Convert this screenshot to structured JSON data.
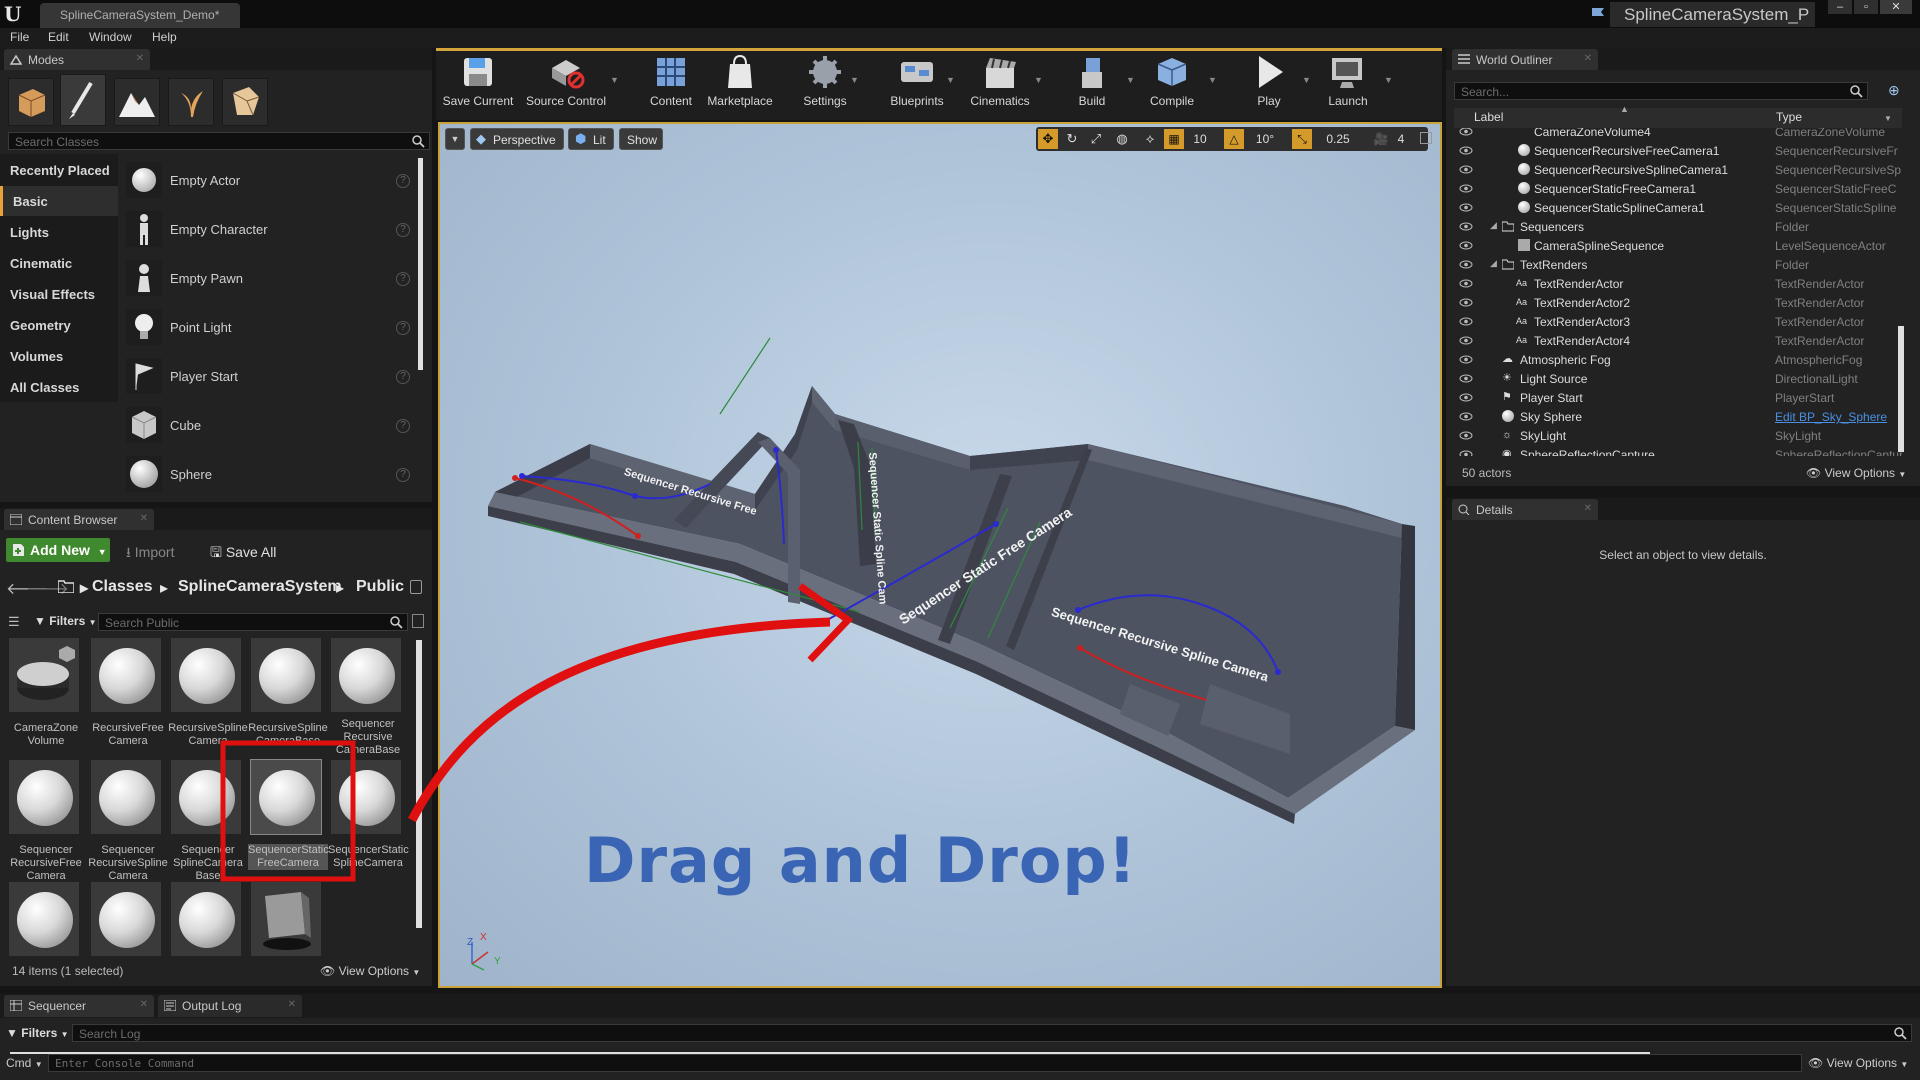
{
  "window": {
    "doc_tab": "SplineCameraSystem_Demo*",
    "project": "SplineCameraSystem_P"
  },
  "menu": [
    "File",
    "Edit",
    "Window",
    "Help"
  ],
  "modes": {
    "tab_label": "Modes",
    "search_placeholder": "Search Classes",
    "categories": [
      "Recently Placed",
      "Basic",
      "Lights",
      "Cinematic",
      "Visual Effects",
      "Geometry",
      "Volumes",
      "All Classes"
    ],
    "selected_category": "Basic",
    "items": [
      "Empty Actor",
      "Empty Character",
      "Empty Pawn",
      "Point Light",
      "Player Start",
      "Cube",
      "Sphere"
    ]
  },
  "toolbar": {
    "buttons": [
      "Save Current",
      "Source Control",
      "Content",
      "Marketplace",
      "Settings",
      "Blueprints",
      "Cinematics",
      "Build",
      "Compile",
      "Play",
      "Launch"
    ]
  },
  "viewport": {
    "perspective": "Perspective",
    "lit": "Lit",
    "show": "Show",
    "grid_snap": "10",
    "rot_snap": "10°",
    "scale_snap": "0.25",
    "cam_speed": "4",
    "labels": [
      "Sequencer Recursive Free",
      "Sequencer Static Spline Cam",
      "Sequencer Static Free Camera",
      "Sequencer Recursive Spline Camera"
    ],
    "overlay_text": "Drag and Drop!",
    "axis_x": "X",
    "axis_z": "Z",
    "axis_y": "Y"
  },
  "content_browser": {
    "tab_label": "Content Browser",
    "add_new": "Add New",
    "import": "Import",
    "save_all": "Save All",
    "path": [
      "Classes",
      "SplineCameraSystem",
      "Public"
    ],
    "filters": "Filters",
    "search_placeholder": "Search Public",
    "assets": [
      "CameraZone Volume",
      "RecursiveFree Camera",
      "RecursiveSpline Camera",
      "RecursiveSpline CameraBase",
      "Sequencer Recursive CameraBase",
      "Sequencer RecursiveFree Camera",
      "Sequencer RecursiveSpline Camera",
      "Sequencer SplineCamera Base",
      "SequencerStatic FreeCamera",
      "SequencerStatic SplineCamera"
    ],
    "status": "14 items (1 selected)",
    "view_options": "View Options"
  },
  "outliner": {
    "tab_label": "World Outliner",
    "search_placeholder": "Search...",
    "col_label": "Label",
    "col_type": "Type",
    "rows": [
      {
        "label": "CameraZoneVolume4",
        "type": "CameraZoneVolume"
      },
      {
        "label": "SequencerRecursiveFreeCamera1",
        "type": "SequencerRecursiveFr"
      },
      {
        "label": "SequencerRecursiveSplineCamera1",
        "type": "SequencerRecursiveSp"
      },
      {
        "label": "SequencerStaticFreeCamera1",
        "type": "SequencerStaticFreeC"
      },
      {
        "label": "SequencerStaticSplineCamera1",
        "type": "SequencerStaticSpline"
      },
      {
        "label": "Sequencers",
        "type": "Folder"
      },
      {
        "label": "CameraSplineSequence",
        "type": "LevelSequenceActor"
      },
      {
        "label": "TextRenders",
        "type": "Folder"
      },
      {
        "label": "TextRenderActor",
        "type": "TextRenderActor"
      },
      {
        "label": "TextRenderActor2",
        "type": "TextRenderActor"
      },
      {
        "label": "TextRenderActor3",
        "type": "TextRenderActor"
      },
      {
        "label": "TextRenderActor4",
        "type": "TextRenderActor"
      },
      {
        "label": "Atmospheric Fog",
        "type": "AtmosphericFog"
      },
      {
        "label": "Light Source",
        "type": "DirectionalLight"
      },
      {
        "label": "Player Start",
        "type": "PlayerStart"
      },
      {
        "label": "Sky Sphere",
        "type": "Edit BP_Sky_Sphere"
      },
      {
        "label": "SkyLight",
        "type": "SkyLight"
      },
      {
        "label": "SphereReflectionCapture",
        "type": "SphereReflectionCapture"
      }
    ],
    "count": "50 actors",
    "view_options": "View Options"
  },
  "details": {
    "tab_label": "Details",
    "message": "Select an object to view details."
  },
  "bottom": {
    "tab_sequencer": "Sequencer",
    "tab_output": "Output Log",
    "filters": "Filters",
    "search_placeholder": "Search Log",
    "cmd": "Cmd",
    "console_placeholder": "Enter Console Command",
    "view_options": "View Options"
  },
  "colors": {
    "accent_green": "#3a8a2e",
    "highlight_red": "#e01010",
    "overlay_blue": "#3a64b4",
    "link_blue": "#4a90e2"
  }
}
